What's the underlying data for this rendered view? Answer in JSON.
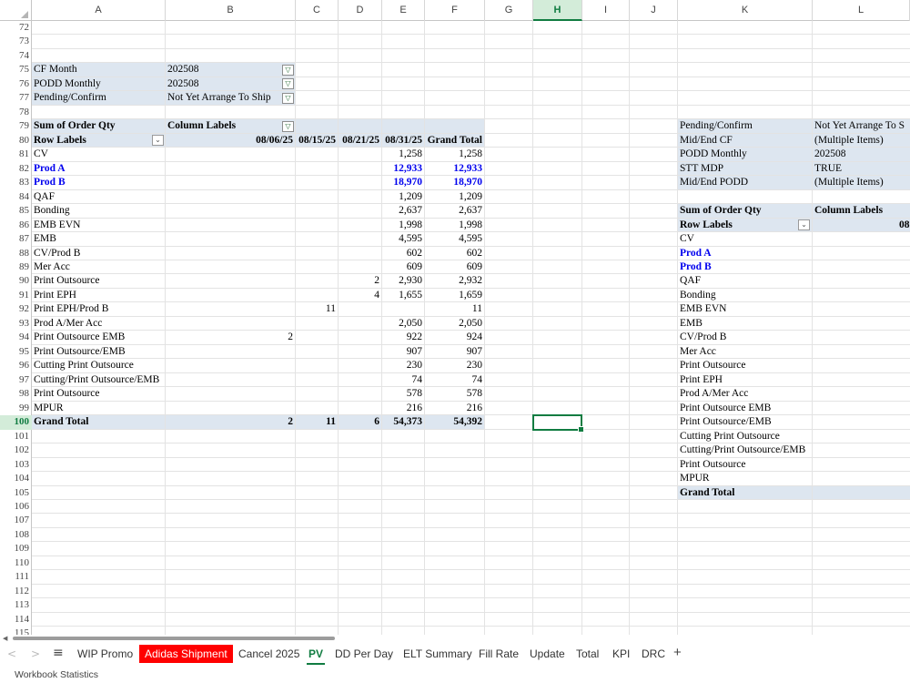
{
  "columns": [
    "A",
    "B",
    "C",
    "D",
    "E",
    "F",
    "G",
    "H",
    "I",
    "J",
    "K",
    "L"
  ],
  "selected_column": "H",
  "rows": [
    "72",
    "73",
    "74",
    "75",
    "76",
    "77",
    "78",
    "79",
    "80",
    "81",
    "82",
    "83",
    "84",
    "85",
    "86",
    "87",
    "88",
    "89",
    "90",
    "91",
    "92",
    "93",
    "94",
    "95",
    "96",
    "97",
    "98",
    "99",
    "100",
    "101",
    "102",
    "103",
    "104",
    "105",
    "106",
    "107",
    "108",
    "109",
    "110",
    "111",
    "112",
    "113",
    "114",
    "115"
  ],
  "selected_row": "100",
  "filters": [
    {
      "label": "CF Month",
      "value": "202508"
    },
    {
      "label": "PODD Monthly",
      "value": "202508"
    },
    {
      "label": "Pending/Confirm",
      "value": "Not Yet Arrange To Ship"
    }
  ],
  "pivot1": {
    "header_values": "Sum of Order Qty",
    "header_columns": "Column Labels",
    "row_labels": "Row Labels",
    "col_dates": [
      "08/06/25",
      "08/15/25",
      "08/21/25",
      "08/31/25",
      "Grand Total"
    ],
    "rows": [
      {
        "label": "CV",
        "c": "",
        "d": "",
        "e": "1,258",
        "f": "1,258",
        "blue": false
      },
      {
        "label": "Prod A",
        "c": "",
        "d": "",
        "e": "12,933",
        "f": "12,933",
        "blue": true
      },
      {
        "label": "Prod B",
        "c": "",
        "d": "",
        "e": "18,970",
        "f": "18,970",
        "blue": true
      },
      {
        "label": "QAF",
        "c": "",
        "d": "",
        "e": "1,209",
        "f": "1,209",
        "blue": false
      },
      {
        "label": "Bonding",
        "c": "",
        "d": "",
        "e": "2,637",
        "f": "2,637",
        "blue": false
      },
      {
        "label": "EMB EVN",
        "c": "",
        "d": "",
        "e": "1,998",
        "f": "1,998",
        "blue": false
      },
      {
        "label": "EMB",
        "c": "",
        "d": "",
        "e": "4,595",
        "f": "4,595",
        "blue": false
      },
      {
        "label": "CV/Prod B",
        "c": "",
        "d": "",
        "e": "602",
        "f": "602",
        "blue": false
      },
      {
        "label": "Mer Acc",
        "c": "",
        "d": "",
        "e": "609",
        "f": "609",
        "blue": false
      },
      {
        "label": "Print Outsource",
        "c": "",
        "d": "2",
        "e": "2,930",
        "f": "2,932",
        "blue": false
      },
      {
        "label": "Print EPH",
        "c": "",
        "d": "4",
        "e": "1,655",
        "f": "1,659",
        "blue": false
      },
      {
        "label": "Print EPH/Prod B",
        "c": "11",
        "d": "",
        "e": "",
        "f": "11",
        "blue": false
      },
      {
        "label": "Prod A/Mer Acc",
        "c": "",
        "d": "",
        "e": "2,050",
        "f": "2,050",
        "blue": false
      },
      {
        "label": "Print Outsource EMB",
        "b": "2",
        "c": "",
        "d": "",
        "e": "922",
        "f": "924",
        "blue": false
      },
      {
        "label": "Print Outsource/EMB",
        "c": "",
        "d": "",
        "e": "907",
        "f": "907",
        "blue": false
      },
      {
        "label": "Cutting Print Outsource",
        "c": "",
        "d": "",
        "e": "230",
        "f": "230",
        "blue": false
      },
      {
        "label": "Cutting/Print Outsource/EMB",
        "c": "",
        "d": "",
        "e": "74",
        "f": "74",
        "blue": false
      },
      {
        "label": "Print Outsource",
        "c": "",
        "d": "",
        "e": "578",
        "f": "578",
        "blue": false
      },
      {
        "label": "MPUR",
        "c": "",
        "d": "",
        "e": "216",
        "f": "216",
        "blue": false
      }
    ],
    "grand_total": {
      "label": "Grand Total",
      "b": "2",
      "c": "11",
      "d": "6",
      "e": "54,373",
      "f": "54,392"
    }
  },
  "pivot2": {
    "filters": [
      {
        "label": "Pending/Confirm",
        "value": "Not Yet Arrange To S"
      },
      {
        "label": "Mid/End CF",
        "value": "(Multiple Items)"
      },
      {
        "label": "PODD Monthly",
        "value": "202508"
      },
      {
        "label": "STT MDP",
        "value": "TRUE"
      },
      {
        "label": "Mid/End PODD",
        "value": "(Multiple Items)"
      }
    ],
    "header_values": "Sum of Order Qty",
    "header_columns": "Column Labels",
    "row_labels": "Row Labels",
    "partial_col": "08",
    "rows": [
      {
        "label": "CV",
        "blue": false
      },
      {
        "label": "Prod A",
        "blue": true
      },
      {
        "label": "Prod B",
        "blue": true
      },
      {
        "label": "QAF",
        "blue": false
      },
      {
        "label": "Bonding",
        "blue": false
      },
      {
        "label": "EMB EVN",
        "blue": false
      },
      {
        "label": "EMB",
        "blue": false
      },
      {
        "label": "CV/Prod B",
        "blue": false
      },
      {
        "label": "Mer Acc",
        "blue": false
      },
      {
        "label": "Print Outsource",
        "blue": false
      },
      {
        "label": "Print EPH",
        "blue": false
      },
      {
        "label": "Prod A/Mer Acc",
        "blue": false
      },
      {
        "label": "Print Outsource EMB",
        "blue": false
      },
      {
        "label": "Print Outsource/EMB",
        "blue": false
      },
      {
        "label": "Cutting Print Outsource",
        "blue": false
      },
      {
        "label": "Cutting/Print Outsource/EMB",
        "blue": false
      },
      {
        "label": "Print Outsource",
        "blue": false
      },
      {
        "label": "MPUR",
        "blue": false
      }
    ],
    "grand_total": "Grand Total"
  },
  "sheet_tabs": [
    {
      "label": "WIP Promo",
      "style": "normal"
    },
    {
      "label": "Adidas Shipment",
      "style": "red"
    },
    {
      "label": "Cancel 2025",
      "style": "normal"
    },
    {
      "label": "PV",
      "style": "active"
    },
    {
      "label": "DD Per Day",
      "style": "normal"
    },
    {
      "label": "ELT Summary",
      "style": "normal"
    },
    {
      "label": "Fill Rate",
      "style": "normal"
    },
    {
      "label": "Update",
      "style": "normal"
    },
    {
      "label": "Total",
      "style": "normal"
    },
    {
      "label": "KPI",
      "style": "normal"
    },
    {
      "label": "DRC",
      "style": "normal"
    }
  ],
  "add_sheet": "+",
  "status_text": "Workbook Statistics",
  "colors": {
    "accent": "#107c41",
    "pivot_shade": "#dde6f0",
    "blue_text": "#0000ee",
    "red_tab": "#ff0000"
  }
}
